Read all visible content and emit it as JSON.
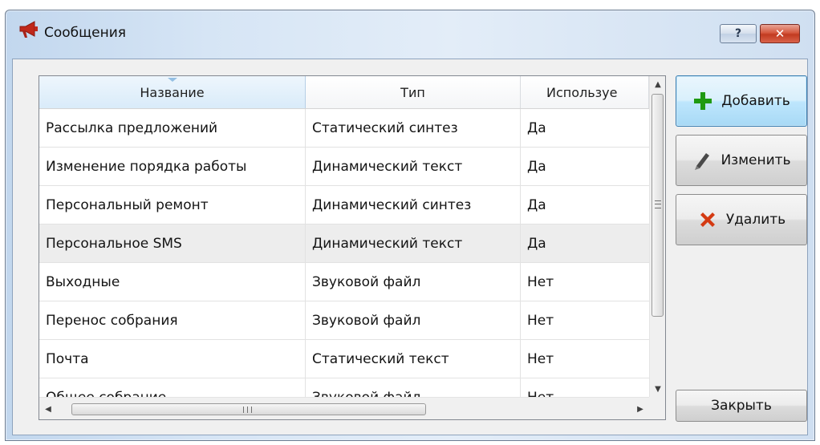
{
  "window": {
    "title": "Сообщения",
    "help_label": "?",
    "close_label": "✕",
    "icon": "megaphone-icon"
  },
  "table": {
    "columns": [
      "Название",
      "Тип",
      "Используе"
    ],
    "sorted_column": "Название",
    "rows": [
      {
        "name": "Рассылка предложений",
        "type": "Статический синтез",
        "used": "Да",
        "selected": false
      },
      {
        "name": "Изменение порядка работы",
        "type": "Динамический текст",
        "used": "Да",
        "selected": false
      },
      {
        "name": "Персональный ремонт",
        "type": "Динамический синтез",
        "used": "Да",
        "selected": false
      },
      {
        "name": "Персональное SMS",
        "type": "Динамический текст",
        "used": "Да",
        "selected": true
      },
      {
        "name": "Выходные",
        "type": "Звуковой файл",
        "used": "Нет",
        "selected": false
      },
      {
        "name": "Перенос собрания",
        "type": "Звуковой файл",
        "used": "Нет",
        "selected": false
      },
      {
        "name": "Почта",
        "type": "Статический текст",
        "used": "Нет",
        "selected": false
      },
      {
        "name": "Общее собрание",
        "type": "Звуковой файл",
        "used": "Нет",
        "selected": false
      }
    ]
  },
  "buttons": {
    "add": "Добавить",
    "edit": "Изменить",
    "delete": "Удалить",
    "close": "Закрыть"
  },
  "colors": {
    "add_icon": "#1f9a12",
    "delete_icon": "#d43a12",
    "edit_icon": "#4a4a4a",
    "title_icon": "#c0281b"
  }
}
